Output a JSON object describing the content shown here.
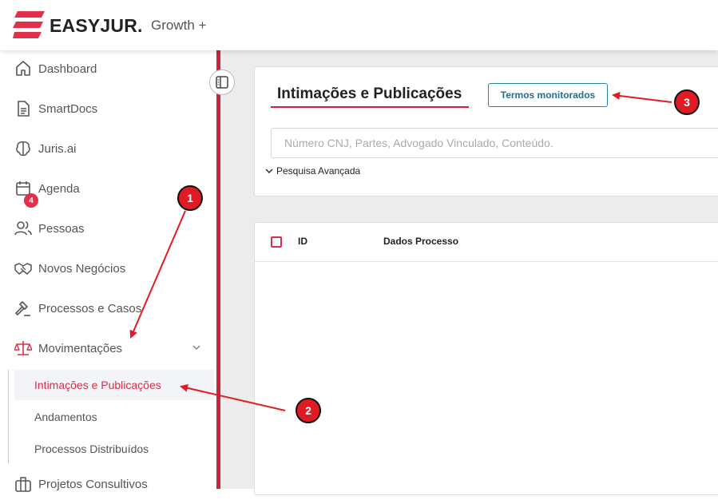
{
  "header": {
    "brand": "EASYJUR.",
    "plan": "Growth +"
  },
  "sidebar": {
    "items": [
      {
        "label": "Dashboard",
        "icon": "home-icon"
      },
      {
        "label": "SmartDocs",
        "icon": "document-icon"
      },
      {
        "label": "Juris.ai",
        "icon": "brain-icon"
      },
      {
        "label": "Agenda",
        "icon": "calendar-icon",
        "badge": "4"
      },
      {
        "label": "Pessoas",
        "icon": "people-icon"
      },
      {
        "label": "Novos Negócios",
        "icon": "handshake-icon"
      },
      {
        "label": "Processos e Casos",
        "icon": "gavel-icon"
      },
      {
        "label": "Movimentações",
        "icon": "scale-icon"
      },
      {
        "label": "Projetos Consultivos",
        "icon": "briefcase-icon"
      }
    ],
    "subitems": [
      {
        "label": "Intimações e Publicações",
        "active": true
      },
      {
        "label": "Andamentos"
      },
      {
        "label": "Processos Distribuídos"
      }
    ],
    "accent_color": "#c8243b"
  },
  "main": {
    "title": "Intimações e Publicações",
    "terms_button": "Termos monitorados",
    "search_placeholder": "Número CNJ, Partes, Advogado Vinculado, Conteúdo.",
    "advanced_search": "Pesquisa Avançada",
    "table_headers": [
      "ID",
      "Dados Processo"
    ]
  },
  "annotations": [
    "1",
    "2",
    "3"
  ]
}
